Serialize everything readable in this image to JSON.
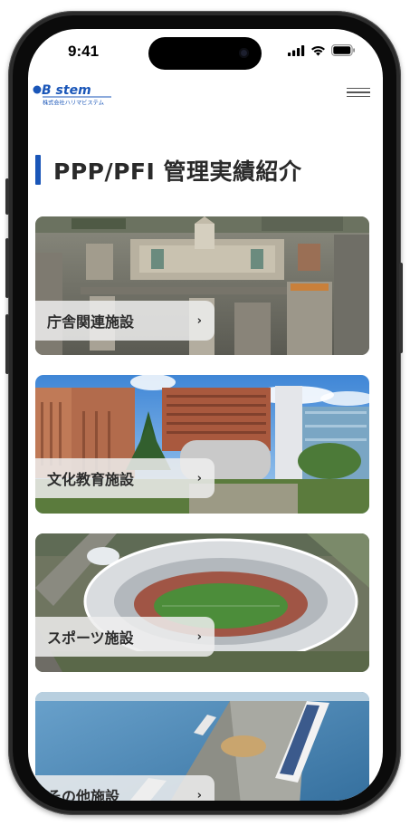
{
  "status_bar": {
    "time": "9:41"
  },
  "header": {
    "logo_text": "B stem",
    "logo_subtext": "株式会社ハリマビステム"
  },
  "page": {
    "title": "PPP/PFI 管理実績紹介"
  },
  "cards": [
    {
      "label": "庁舎関連施設",
      "chevron": "›"
    },
    {
      "label": "文化教育施設",
      "chevron": "›"
    },
    {
      "label": "スポーツ施設",
      "chevron": "›"
    },
    {
      "label": "その他施設",
      "chevron": "›"
    }
  ],
  "colors": {
    "accent": "#1a56b8",
    "label_bg": "#eeeeee",
    "title_text": "#2a2a2a"
  },
  "icons": [
    "signal-icon",
    "wifi-icon",
    "battery-icon",
    "hamburger-menu-icon",
    "chevron-right-icon"
  ]
}
